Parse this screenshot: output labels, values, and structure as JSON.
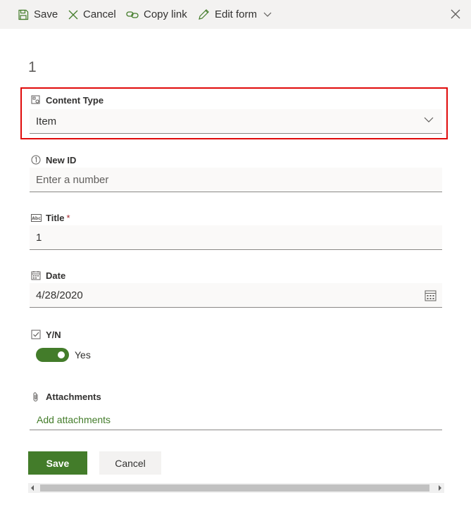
{
  "commandbar": {
    "save_label": "Save",
    "cancel_label": "Cancel",
    "copy_link_label": "Copy link",
    "edit_form_label": "Edit form",
    "icons": [
      "save-icon",
      "cancel-icon",
      "link-icon",
      "pencil-icon",
      "chevron-down-icon",
      "close-icon"
    ]
  },
  "item": {
    "title": "1"
  },
  "fields": {
    "content_type": {
      "label": "Content Type",
      "value": "Item",
      "icon": "content-type-icon"
    },
    "new_id": {
      "label": "New ID",
      "placeholder": "Enter a number",
      "icon": "number-icon"
    },
    "title": {
      "label": "Title",
      "required_mark": "*",
      "value": "1",
      "icon": "text-abc-icon"
    },
    "date": {
      "label": "Date",
      "value": "4/28/2020",
      "icon": "calendar-icon"
    },
    "yn": {
      "label": "Y/N",
      "state": "Yes",
      "checked": true,
      "icon": "checkbox-icon"
    },
    "attachments": {
      "label": "Attachments",
      "link": "Add attachments",
      "icon": "paperclip-icon"
    }
  },
  "footer": {
    "save_label": "Save",
    "cancel_label": "Cancel"
  },
  "colors": {
    "accent": "#437c2a",
    "highlight_border": "#e00b0b",
    "field_bg": "#faf9f8",
    "commandbar_bg": "#f3f2f1"
  }
}
